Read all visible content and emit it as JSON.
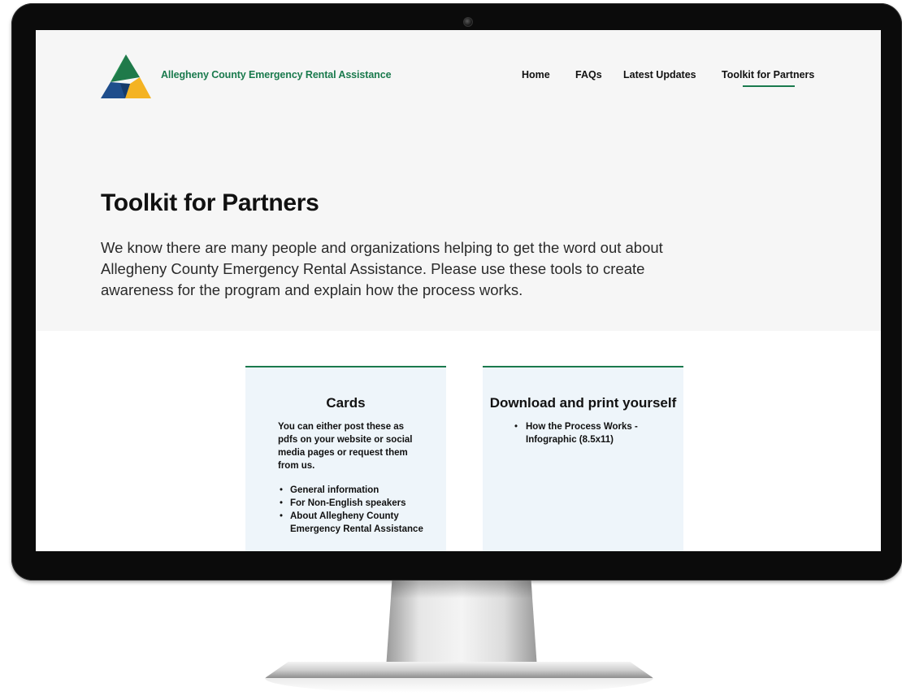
{
  "site": {
    "title": "Allegheny County Emergency Rental Assistance",
    "brand_colors": {
      "green": "#1a7a4d",
      "dark_green": "#1f6b45",
      "blue": "#1f4e8c",
      "yellow": "#f4b323"
    }
  },
  "nav": {
    "items": [
      {
        "label": "Home"
      },
      {
        "label": "FAQs"
      },
      {
        "label": "Latest Updates"
      },
      {
        "label": "Toolkit for Partners",
        "active": true
      }
    ]
  },
  "hero": {
    "title": "Toolkit for Partners",
    "intro": "We know there are many people and organizations helping to get the word out about Allegheny County Emergency Rental Assistance. Please use these tools to create awareness for the program and explain how the process works."
  },
  "cards": [
    {
      "title": "Cards",
      "description": "You can either post these as pdfs on your website or social media pages or request them from us.",
      "items": [
        "General  information",
        "For Non-English speakers",
        "About Allegheny County Emergency Rental Assistance"
      ]
    },
    {
      "title": "Download and print yourself",
      "items": [
        "How the Process Works - Infographic (8.5x11)"
      ]
    }
  ],
  "icons": {
    "logo": "triangle-logo-icon",
    "bullet": "bullet-dot"
  }
}
